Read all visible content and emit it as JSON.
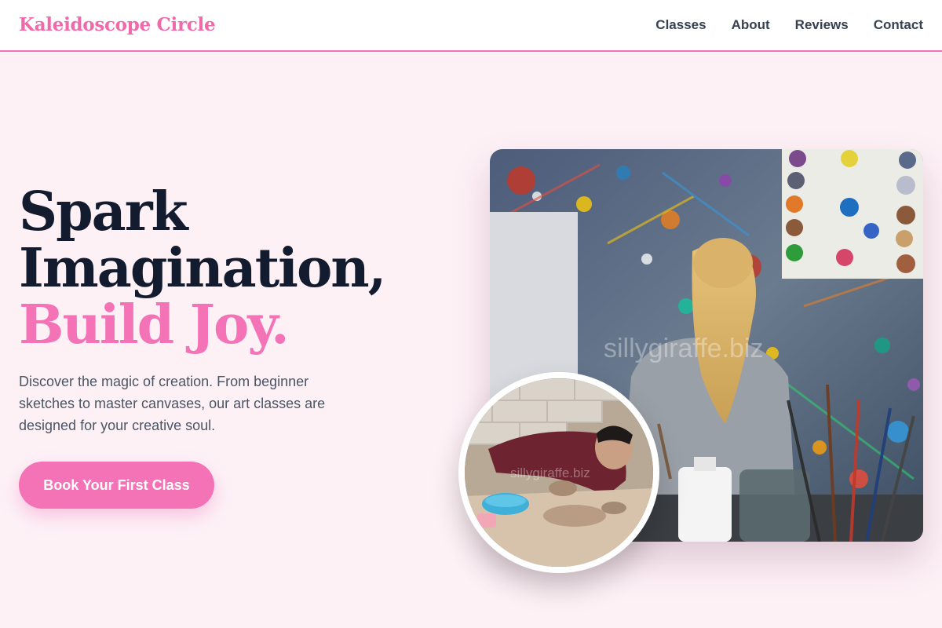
{
  "header": {
    "logo": "Kaleidoscope Circle",
    "nav": [
      "Classes",
      "About",
      "Reviews",
      "Contact"
    ]
  },
  "hero": {
    "title_line1": "Spark",
    "title_line2": "Imagination,",
    "title_line3": "Build Joy.",
    "description": "Discover the magic of creation. From beginner sketches to master canvases, our art classes are designed for your creative soul.",
    "cta_label": "Book Your First Class"
  },
  "images": {
    "main_watermark": "sillygiraffe.biz",
    "circle_watermark": "sillygiraffe.biz"
  },
  "colors": {
    "accent": "#f472b6",
    "background": "#fdf1f6",
    "heading": "#131b2e"
  }
}
